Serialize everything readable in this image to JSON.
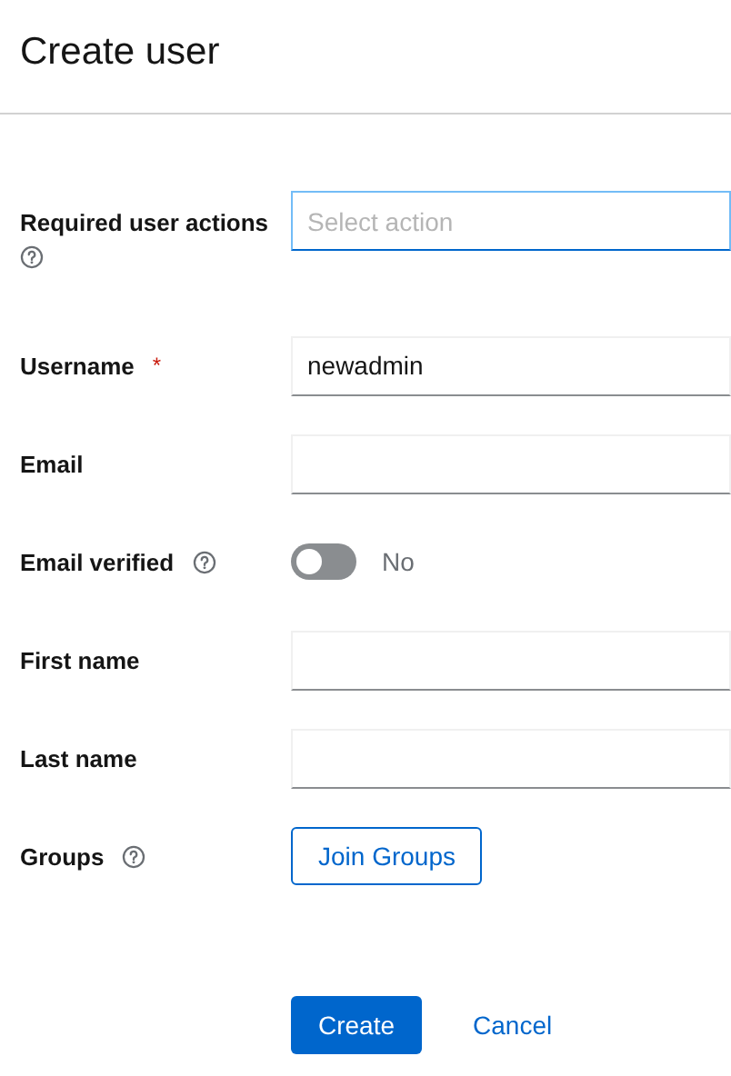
{
  "title": "Create user",
  "fields": [
    {
      "kind": "select",
      "label": "Required user actions",
      "help": true,
      "placeholder": "Select action",
      "focused": true
    },
    {
      "kind": "text",
      "label": "Username",
      "required_mark": "*",
      "value": "newadmin",
      "focused": false
    },
    {
      "kind": "text",
      "label": "Email",
      "focused": false
    },
    {
      "kind": "toggle",
      "label": "Email verified",
      "help": true,
      "on": false,
      "state_label": "No"
    },
    {
      "kind": "text",
      "label": "First name",
      "focused": false
    },
    {
      "kind": "text",
      "label": "Last name",
      "focused": false
    },
    {
      "kind": "button",
      "label": "Groups",
      "help": true,
      "button_label": "Join Groups"
    }
  ],
  "actions": [
    {
      "kind": "primary",
      "label": "Create"
    },
    {
      "kind": "link",
      "label": "Cancel"
    }
  ]
}
